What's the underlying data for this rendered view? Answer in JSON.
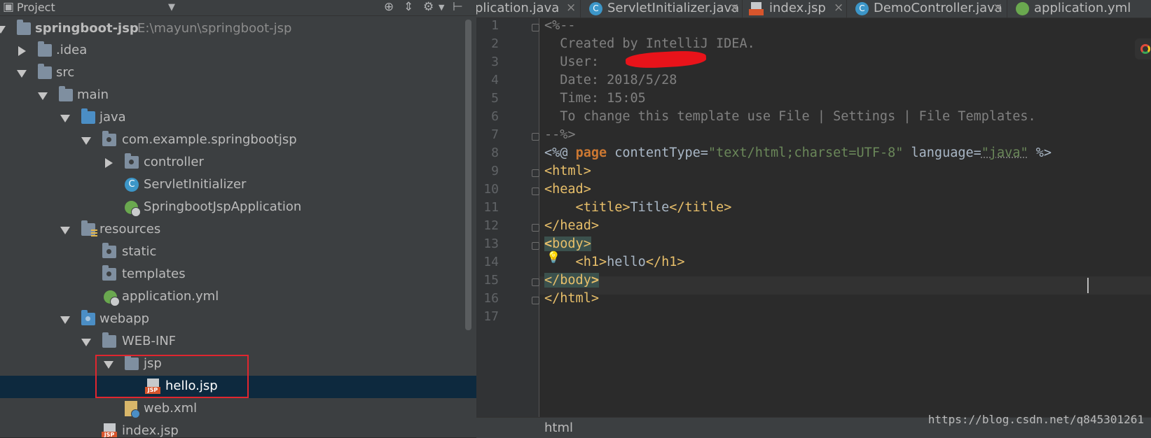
{
  "project_panel": {
    "title": "Project",
    "tree": [
      {
        "label": "springboot-jsp",
        "path": "E:\\mayun\\springboot-jsp",
        "icon": "module-folder-icon",
        "expanded": true
      },
      {
        "label": ".idea",
        "icon": "folder-icon",
        "expanded": false
      },
      {
        "label": "src",
        "icon": "folder-icon",
        "expanded": true
      },
      {
        "label": "main",
        "icon": "folder-icon",
        "expanded": true
      },
      {
        "label": "java",
        "icon": "source-folder-icon",
        "expanded": true
      },
      {
        "label": "com.example.springbootjsp",
        "icon": "package-icon",
        "expanded": true
      },
      {
        "label": "controller",
        "icon": "package-icon",
        "expanded": false
      },
      {
        "label": "ServletInitializer",
        "icon": "class-icon"
      },
      {
        "label": "SpringbootJspApplication",
        "icon": "spring-boot-class-icon"
      },
      {
        "label": "resources",
        "icon": "resources-folder-icon",
        "expanded": true
      },
      {
        "label": "static",
        "icon": "package-icon"
      },
      {
        "label": "templates",
        "icon": "package-icon"
      },
      {
        "label": "application.yml",
        "icon": "spring-config-icon"
      },
      {
        "label": "webapp",
        "icon": "web-folder-icon",
        "expanded": true
      },
      {
        "label": "WEB-INF",
        "icon": "folder-icon",
        "expanded": true
      },
      {
        "label": "jsp",
        "icon": "folder-icon",
        "expanded": true
      },
      {
        "label": "hello.jsp",
        "icon": "jsp-file-icon",
        "selected": true
      },
      {
        "label": "web.xml",
        "icon": "web-xml-icon"
      },
      {
        "label": "index.jsp",
        "icon": "jsp-file-icon"
      }
    ],
    "highlight_color": "#e0262f",
    "selection_color": "#0d293e"
  },
  "editor": {
    "tabs": [
      {
        "label": "plication.java",
        "icon": "spring-boot-class-icon"
      },
      {
        "label": "ServletInitializer.java",
        "icon": "class-icon"
      },
      {
        "label": "index.jsp",
        "icon": "jsp-file-icon"
      },
      {
        "label": "DemoController.java",
        "icon": "class-icon"
      },
      {
        "label": "application.yml",
        "icon": "spring-config-icon"
      }
    ],
    "close_glyph": "×",
    "line_numbers": [
      "1",
      "2",
      "3",
      "4",
      "5",
      "6",
      "7",
      "8",
      "9",
      "10",
      "11",
      "12",
      "13",
      "14",
      "15",
      "16",
      "17"
    ],
    "lines": {
      "l1": "<%--",
      "l2": "  Created by IntelliJ IDEA.",
      "l3": "  User: ",
      "l4": "  Date: 2018/5/28",
      "l5": "  Time: 15:05",
      "l6": "  To change this template use File | Settings | File Templates.",
      "l7": "--%>",
      "l8_open": "<%@ ",
      "l8_kw": "page",
      "l8_attr1": " contentType=",
      "l8_val1": "\"text/html;charset=UTF-8\"",
      "l8_attr2": " language=",
      "l8_val2": "\"java\"",
      "l8_close": " %>",
      "l9": "<html>",
      "l10": "<head>",
      "l11_open": "    <title>",
      "l11_text": "Title",
      "l11_close": "</title>",
      "l12": "</head>",
      "l13_lt": "<",
      "l13_rest": "body>",
      "l14_open": "    <h1>",
      "l14_text": "hello",
      "l14_close": "</h1>",
      "l15_main": "</body",
      "l15_gt": ">",
      "l16": "</html>"
    },
    "breadcrumb": "html",
    "watermark": "https://blog.csdn.net/q845301261"
  },
  "colors": {
    "tag": "#e8bf6a",
    "keyword": "#cc7832",
    "string": "#6a8759",
    "comment": "#808080",
    "text": "#a9b7c6"
  }
}
